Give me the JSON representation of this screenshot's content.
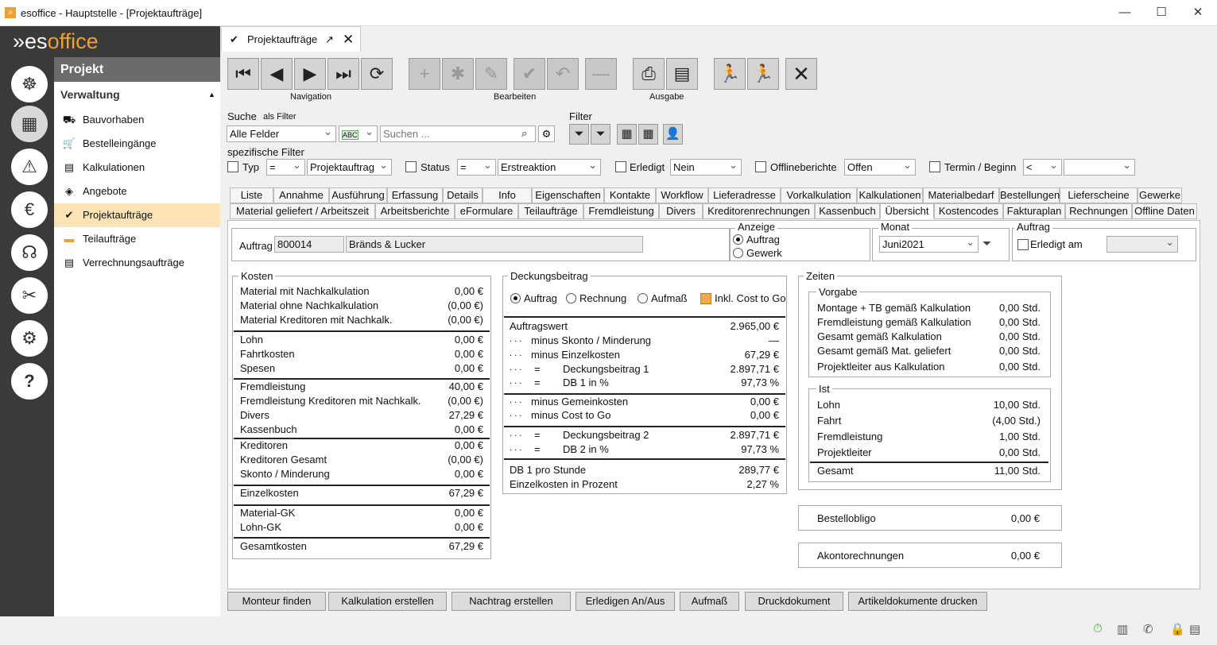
{
  "window": {
    "title": "esoffice - Hauptstelle - [Projektaufträge]"
  },
  "logo": {
    "prefix": "es",
    "rest": "office"
  },
  "nav": {
    "header": "Projekt",
    "section": "Verwaltung",
    "items": [
      "Bauvorhaben",
      "Bestelleingänge",
      "Kalkulationen",
      "Angebote",
      "Projektaufträge",
      "Teilaufträge",
      "Verrechnungsaufträge"
    ]
  },
  "doctab": {
    "label": "Projektaufträge"
  },
  "toolbar": {
    "navigation": "Navigation",
    "bearbeiten": "Bearbeiten",
    "ausgabe": "Ausgabe"
  },
  "search": {
    "label": "Suche",
    "as_filter": "als Filter",
    "field": "Alle Felder",
    "placeholder": "Suchen ...",
    "filter_label": "Filter",
    "specific": "spezifische Filter"
  },
  "filters": {
    "typ": "Typ",
    "typ_op": "=",
    "typ_val": "Projektauftrag",
    "status": "Status",
    "status_op": "=",
    "status_val": "Erstreaktion",
    "erledigt": "Erledigt",
    "erledigt_val": "Nein",
    "offline": "Offlineberichte",
    "offline_val": "Offen",
    "termin": "Termin / Beginn",
    "termin_op": "<"
  },
  "tabs_row1": [
    "Liste",
    "Annahme",
    "Ausführung",
    "Erfassung",
    "Details",
    "Info",
    "Eigenschaften",
    "Kontakte",
    "Workflow",
    "Lieferadresse",
    "Vorkalkulation",
    "Kalkulationen",
    "Materialbedarf",
    "Bestellungen",
    "Lieferscheine",
    "Gewerke"
  ],
  "tabs_row2": [
    "Material geliefert / Arbeitszeit",
    "Arbeitsberichte",
    "eFormulare",
    "Teilaufträge",
    "Fremdleistung",
    "Divers",
    "Kreditorenrechnungen",
    "Kassenbuch",
    "Übersicht",
    "Kostencodes",
    "Fakturaplan",
    "Rechnungen",
    "Offline Daten"
  ],
  "auftrag": {
    "label": "Auftrag",
    "nr": "800014",
    "name": "Bränds & Lucker",
    "anzeige": "Anzeige",
    "opt1": "Auftrag",
    "opt2": "Gewerk",
    "monat_label": "Monat",
    "monat": "Juni2021",
    "auftrag_label": "Auftrag",
    "erledigt_am": "Erledigt am"
  },
  "kosten": {
    "title": "Kosten",
    "rows": [
      [
        "Material mit Nachkalkulation",
        "0,00 €"
      ],
      [
        "Material ohne Nachkalkulation",
        "(0,00 €)"
      ],
      [
        "Material Kreditoren mit Nachkalk.",
        "(0,00 €)"
      ],
      [
        "Lohn",
        "0,00 €"
      ],
      [
        "Fahrtkosten",
        "0,00 €"
      ],
      [
        "Spesen",
        "0,00 €"
      ],
      [
        "Fremdleistung",
        "40,00 €"
      ],
      [
        "Fremdleistung Kreditoren mit Nachkalk.",
        "(0,00 €)"
      ],
      [
        "Divers",
        "27,29 €"
      ],
      [
        "Kassenbuch",
        "0,00 €"
      ],
      [
        "Kreditoren",
        "0,00 €"
      ],
      [
        "Kreditoren Gesamt",
        "(0,00 €)"
      ],
      [
        "Skonto / Minderung",
        "0,00 €"
      ],
      [
        "Einzelkosten",
        "67,29 €"
      ],
      [
        "Material-GK",
        "0,00 €"
      ],
      [
        "Lohn-GK",
        "0,00 €"
      ],
      [
        "Gesamtkosten",
        "67,29 €"
      ]
    ]
  },
  "deckung": {
    "title": "Deckungsbeitrag",
    "opt1": "Auftrag",
    "opt2": "Rechnung",
    "opt3": "Aufmaß",
    "inkl": "Inkl. Cost to Go",
    "dots": ". . .",
    "eq": "=",
    "rows": [
      [
        "Auftragswert",
        "2.965,00 €"
      ],
      [
        "minus Skonto / Minderung",
        "—"
      ],
      [
        "minus Einzelkosten",
        "67,29 €"
      ],
      [
        "Deckungsbeitrag 1",
        "2.897,71 €"
      ],
      [
        "DB 1 in %",
        "97,73 %"
      ],
      [
        "minus Gemeinkosten",
        "0,00 €"
      ],
      [
        "minus Cost to Go",
        "0,00 €"
      ],
      [
        "Deckungsbeitrag 2",
        "2.897,71 €"
      ],
      [
        "DB 2 in %",
        "97,73 %"
      ],
      [
        "DB 1 pro Stunde",
        "289,77 €"
      ],
      [
        "Einzelkosten in  Prozent",
        "2,27 %"
      ]
    ]
  },
  "zeiten": {
    "title": "Zeiten",
    "vorgabe": "Vorgabe",
    "vrows": [
      [
        "Montage + TB gemäß Kalkulation",
        "0,00 Std."
      ],
      [
        "Fremdleistung gemäß Kalkulation",
        "0,00 Std."
      ],
      [
        "Gesamt gemäß Kalkulation",
        "0,00 Std."
      ],
      [
        "Gesamt gemäß Mat. geliefert",
        "0,00 Std."
      ],
      [
        "Projektleiter aus Kalkulation",
        "0,00 Std."
      ]
    ],
    "ist": "Ist",
    "irows": [
      [
        "Lohn",
        "10,00 Std."
      ],
      [
        "Fahrt",
        "(4,00 Std.)"
      ],
      [
        "Fremdleistung",
        "1,00 Std."
      ],
      [
        "Projektleiter",
        "0,00 Std."
      ],
      [
        "Gesamt",
        "11,00 Std."
      ]
    ],
    "bestell": "Bestellobligo",
    "bestell_val": "0,00 €",
    "akonto": "Akontorechnungen",
    "akonto_val": "0,00 €"
  },
  "buttons": [
    "Monteur finden",
    "Kalkulation erstellen",
    "Nachtrag erstellen",
    "Erledigen An/Aus",
    "Aufmaß",
    "Druckdokument",
    "Artikeldokumente drucken"
  ]
}
